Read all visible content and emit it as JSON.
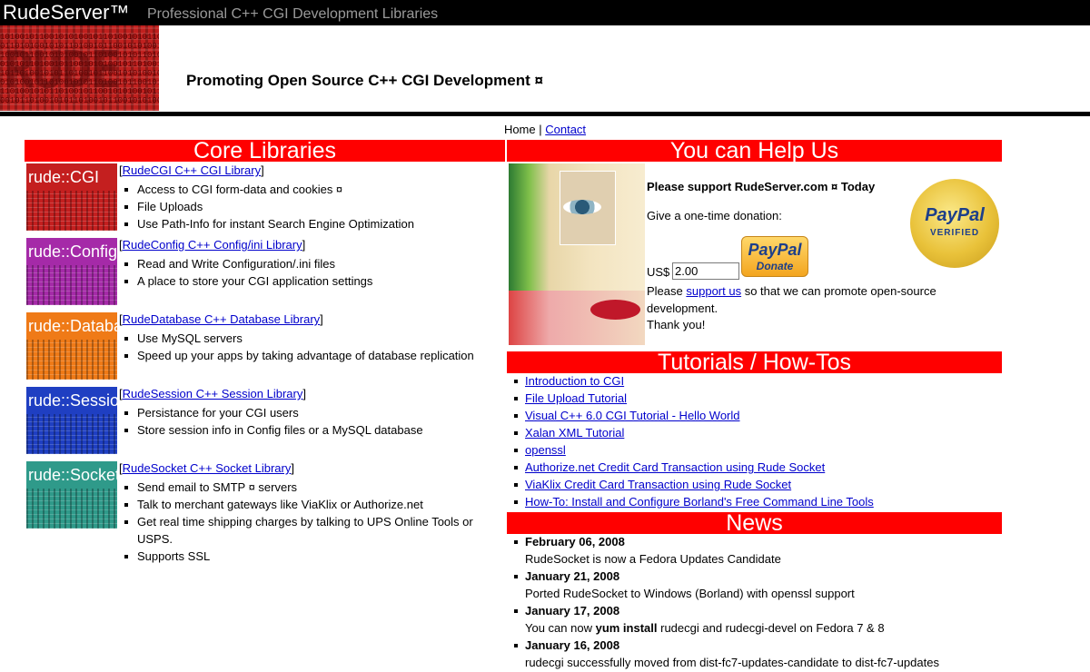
{
  "header": {
    "brand": "RudeServer™",
    "tagline": "Professional C++ CGI Development Libraries",
    "promo": "Promoting Open Source C++ CGI Development ¤",
    "logo_text": "RUDE"
  },
  "nav": {
    "home": "Home",
    "separator": " | ",
    "contact": "Contact"
  },
  "core": {
    "title": "Core Libraries",
    "libraries": [
      {
        "image_label": "rude::CGI",
        "color": "#c41f1f",
        "link": "RudeCGI C++ CGI Library",
        "features": [
          "Access to CGI form-data and cookies ¤",
          "File Uploads",
          "Use Path-Info for instant Search Engine Optimization"
        ]
      },
      {
        "image_label": "rude::Config",
        "color": "#a52aa8",
        "link": "RudeConfig C++ Config/ini Library",
        "features": [
          "Read and Write Configuration/.ini files",
          "A place to store your CGI application settings"
        ]
      },
      {
        "image_label": "rude::Database",
        "color": "#ef7a17",
        "link": "RudeDatabase C++ Database Library",
        "features": [
          "Use MySQL servers",
          "Speed up your apps by taking advantage of database replication"
        ]
      },
      {
        "image_label": "rude::Session",
        "color": "#1f3fc2",
        "link": "RudeSession C++ Session Library",
        "features": [
          "Persistance for your CGI users",
          "Store session info in Config files or a MySQL database"
        ]
      },
      {
        "image_label": "rude::Socket",
        "color": "#2f9a8a",
        "link": "RudeSocket C++ Socket Library",
        "features": [
          "Send email to SMTP ¤ servers",
          "Talk to merchant gateways like ViaKlix or Authorize.net",
          "Get real time shipping charges by talking to UPS Online Tools or USPS.",
          "Supports SSL"
        ]
      }
    ]
  },
  "help": {
    "title": "You can Help Us",
    "headline": "Please support RudeServer.com ¤ Today",
    "donation_prompt": "Give a one-time donation:",
    "currency": "US$",
    "amount": "2.00",
    "donate_logo": "PayPal",
    "donate_label": "Donate",
    "support_prefix": "Please ",
    "support_link": "support us",
    "support_suffix": " so that we can promote open-source development.",
    "thanks": "Thank you!",
    "seal_word": "PayPal",
    "seal_sub": "VERIFIED"
  },
  "tutorials": {
    "title": "Tutorials / How-Tos",
    "items": [
      "Introduction to CGI",
      "File Upload Tutorial",
      "Visual C++ 6.0 CGI Tutorial - Hello World",
      "Xalan XML Tutorial",
      "openssl",
      "Authorize.net Credit Card Transaction using Rude Socket",
      "ViaKlix Credit Card Transaction using Rude Socket",
      "How-To: Install and Configure Borland's Free Command Line Tools"
    ]
  },
  "news": {
    "title": "News",
    "items": [
      {
        "date": "February 06, 2008",
        "text_before": "RudeSocket is now a Fedora Updates Candidate",
        "text_bold": "",
        "text_after": ""
      },
      {
        "date": "January 21, 2008",
        "text_before": "Ported RudeSocket to Windows (Borland) with openssl support",
        "text_bold": "",
        "text_after": ""
      },
      {
        "date": "January 17, 2008",
        "text_before": "You can now ",
        "text_bold": "yum install",
        "text_after": " rudecgi and rudecgi-devel on Fedora 7 & 8"
      },
      {
        "date": "January 16, 2008",
        "text_before": "rudecgi successfully moved from dist-fc7-updates-candidate to dist-fc7-updates",
        "text_bold": "",
        "text_after": ""
      }
    ]
  }
}
